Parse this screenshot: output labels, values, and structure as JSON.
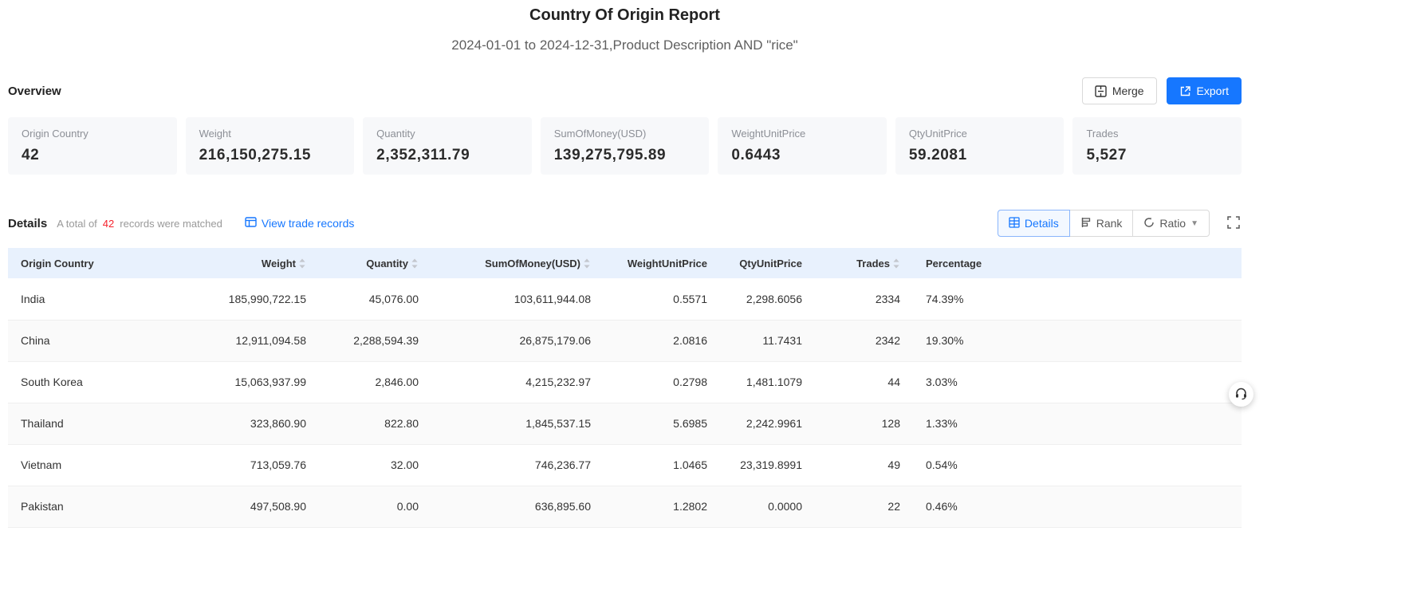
{
  "header": {
    "title": "Country Of Origin Report",
    "subtitle": "2024-01-01 to 2024-12-31,Product Description AND \"rice\""
  },
  "overview": {
    "label": "Overview",
    "merge_label": "Merge",
    "export_label": "Export",
    "cards": [
      {
        "label": "Origin Country",
        "value": "42"
      },
      {
        "label": "Weight",
        "value": "216,150,275.15"
      },
      {
        "label": "Quantity",
        "value": "2,352,311.79"
      },
      {
        "label": "SumOfMoney(USD)",
        "value": "139,275,795.89"
      },
      {
        "label": "WeightUnitPrice",
        "value": "0.6443"
      },
      {
        "label": "QtyUnitPrice",
        "value": "59.2081"
      },
      {
        "label": "Trades",
        "value": "5,527"
      }
    ]
  },
  "details": {
    "label": "Details",
    "total_prefix": "A total of",
    "total_count": "42",
    "total_suffix": "records were matched",
    "view_link": "View trade records",
    "toggles": {
      "details": "Details",
      "rank": "Rank",
      "ratio": "Ratio"
    }
  },
  "table": {
    "columns": [
      {
        "label": "Origin Country",
        "align": "left",
        "sortable": false
      },
      {
        "label": "Weight",
        "align": "right",
        "sortable": true
      },
      {
        "label": "Quantity",
        "align": "right",
        "sortable": true
      },
      {
        "label": "SumOfMoney(USD)",
        "align": "right",
        "sortable": true
      },
      {
        "label": "WeightUnitPrice",
        "align": "right",
        "sortable": false
      },
      {
        "label": "QtyUnitPrice",
        "align": "right",
        "sortable": false
      },
      {
        "label": "Trades",
        "align": "right",
        "sortable": true
      },
      {
        "label": "Percentage",
        "align": "left",
        "sortable": false
      }
    ],
    "rows": [
      [
        "India",
        "185,990,722.15",
        "45,076.00",
        "103,611,944.08",
        "0.5571",
        "2,298.6056",
        "2334",
        "74.39%"
      ],
      [
        "China",
        "12,911,094.58",
        "2,288,594.39",
        "26,875,179.06",
        "2.0816",
        "11.7431",
        "2342",
        "19.30%"
      ],
      [
        "South Korea",
        "15,063,937.99",
        "2,846.00",
        "4,215,232.97",
        "0.2798",
        "1,481.1079",
        "44",
        "3.03%"
      ],
      [
        "Thailand",
        "323,860.90",
        "822.80",
        "1,845,537.15",
        "5.6985",
        "2,242.9961",
        "128",
        "1.33%"
      ],
      [
        "Vietnam",
        "713,059.76",
        "32.00",
        "746,236.77",
        "1.0465",
        "23,319.8991",
        "49",
        "0.54%"
      ],
      [
        "Pakistan",
        "497,508.90",
        "0.00",
        "636,895.60",
        "1.2802",
        "0.0000",
        "22",
        "0.46%"
      ]
    ]
  },
  "colors": {
    "accent": "#1677ff",
    "count_red": "#f5222d",
    "table_header_bg": "#e8f1fd"
  }
}
